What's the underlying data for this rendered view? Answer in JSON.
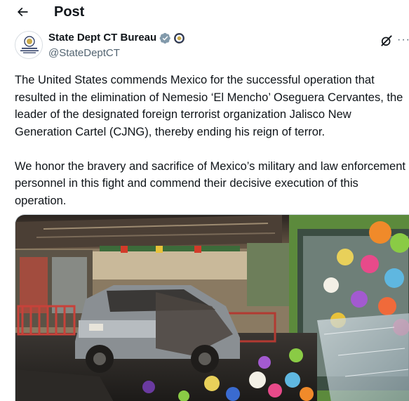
{
  "header": {
    "title": "Post",
    "back_icon": "arrow-left-icon"
  },
  "post": {
    "author": {
      "display_name": "State Dept CT Bureau",
      "handle": "@StateDeptCT",
      "avatar_text": "Bureau of Counterterrorism",
      "verified_badge": "verified-gray-icon",
      "affiliate_badge": "seal-icon"
    },
    "menu_icons": [
      "grok-icon",
      "more-icon"
    ],
    "paragraphs": [
      "The United States commends Mexico for the successful operation that resulted in the elimination of Nemesio ‘El Mencho’ Oseguera Cervantes, the leader of the designated foreign terrorist organization Jalisco New Generation Cartel (CJNG), thereby ending his reign of terror.",
      "We honor the bravery and sacrifice of Mexico’s military and law enforcement personnel in this fight and commend their decisive execution of this operation."
    ],
    "media": {
      "kind": "photo",
      "subject": "burned-out-car-in-store-entrance"
    }
  },
  "colors": {
    "text": "#0f1419",
    "secondary": "#536471",
    "verified": "#829aab",
    "border": "#cfd9de"
  }
}
